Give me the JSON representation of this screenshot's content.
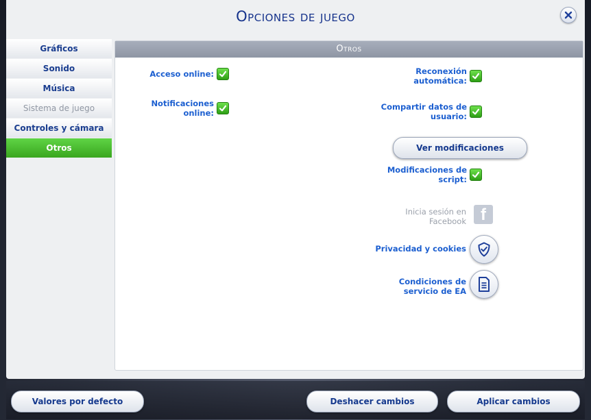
{
  "window": {
    "title": "Opciones de juego"
  },
  "icons": {
    "close": "close-icon",
    "check": "check-icon",
    "facebook": "facebook-icon",
    "privacy": "shield-check-icon",
    "terms": "document-icon"
  },
  "colors": {
    "accent_green": "#3aa61f",
    "label_blue": "#1c5fd0",
    "title_blue": "#16338c"
  },
  "sidebar": {
    "items": [
      {
        "label": "Gráficos"
      },
      {
        "label": "Sonido"
      },
      {
        "label": "Música"
      },
      {
        "label": "Sistema de juego"
      },
      {
        "label": "Controles y cámara"
      },
      {
        "label": "Otros"
      }
    ]
  },
  "panel": {
    "header": "Otros",
    "left_options": [
      {
        "label": "Acceso online:",
        "checked": true
      },
      {
        "label": "Notificaciones online:",
        "checked": true
      }
    ],
    "right_options": [
      {
        "label_line1": "Reconexión",
        "label_line2": "automática:",
        "checked": true
      },
      {
        "label_line1": "Compartir datos de",
        "label_line2": "usuario:",
        "checked": true
      },
      {
        "label_line1": "Modificaciones de",
        "label_line2": "script:",
        "checked": true
      }
    ],
    "view_mods_button": "Ver modificaciones",
    "facebook": {
      "line1": "Inicia sesión en",
      "line2": "Facebook"
    },
    "privacy": {
      "label": "Privacidad y cookies"
    },
    "terms": {
      "line1": "Condiciones de",
      "line2": "servicio de EA"
    }
  },
  "footer": {
    "defaults_button": "Valores por defecto",
    "undo_button": "Deshacer cambios",
    "apply_button": "Aplicar cambios"
  }
}
